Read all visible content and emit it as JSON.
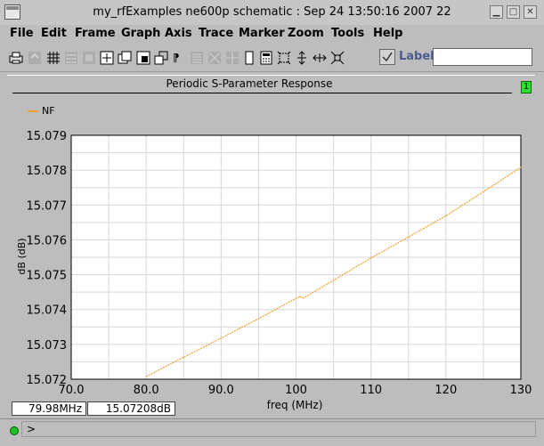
{
  "window": {
    "title": "my_rfExamples ne600p schematic : Sep 24 13:50:16 2007 22",
    "controls": [
      "minimize",
      "maximize",
      "close"
    ]
  },
  "menu": [
    "File",
    "Edit",
    "Frame",
    "Graph",
    "Axis",
    "Trace",
    "Marker",
    "Zoom",
    "Tools",
    "Help"
  ],
  "toolbar": {
    "tools": [
      "print-icon",
      "undo-icon",
      "grid-icon",
      "strip-icon",
      "frame-icon",
      "fit-icon",
      "new-window-icon",
      "subwindow-icon",
      "cascade-icon",
      "text-icon",
      "list-icon",
      "crosshair-icon",
      "grid-dim-icon",
      "move-icon",
      "calculator-icon",
      "zoom-box-icon",
      "zoom-y-icon",
      "zoom-x-icon",
      "zoom-fit-icon"
    ],
    "label_text": "Label",
    "label_value": ""
  },
  "graph": {
    "title": "Periodic S-Parameter Response",
    "badge": "1",
    "legend": "NF",
    "readout_x": "79.98MHz",
    "readout_y": "15.07208dB"
  },
  "chart_data": {
    "type": "line",
    "title": "Periodic S-Parameter Response",
    "xlabel": "freq (MHz)",
    "ylabel": "dB (dB)",
    "xlim": [
      70,
      130
    ],
    "ylim": [
      15.072,
      15.079
    ],
    "xticks": [
      "70.0",
      "80.0",
      "90.0",
      "100",
      "110",
      "120",
      "130"
    ],
    "yticks": [
      "15.072",
      "15.073",
      "15.074",
      "15.075",
      "15.076",
      "15.077",
      "15.078",
      "15.079"
    ],
    "grid": true,
    "legend_position": "top-left",
    "series": [
      {
        "name": "NF",
        "color": "#f0a030",
        "x": [
          80,
          85,
          90,
          95,
          100,
          100.5,
          101,
          105,
          110,
          115,
          120,
          125,
          130
        ],
        "y": [
          15.07208,
          15.07263,
          15.07318,
          15.07374,
          15.07432,
          15.07437,
          15.07433,
          15.07484,
          15.07548,
          15.07608,
          15.07669,
          15.07738,
          15.07808
        ]
      }
    ]
  },
  "status": {
    "prompt": ">"
  }
}
